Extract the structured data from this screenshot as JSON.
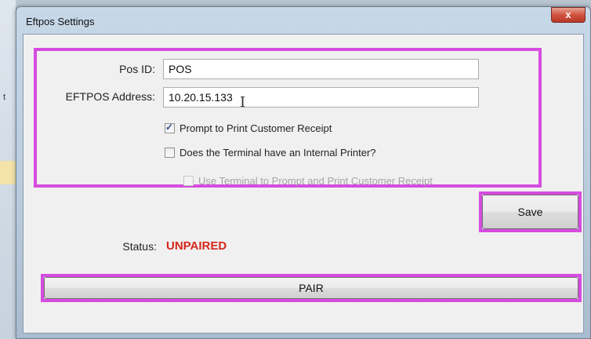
{
  "window": {
    "title": "Eftpos Settings",
    "close_label": "x"
  },
  "form": {
    "pos_id_label": "Pos ID:",
    "pos_id_value": "POS",
    "eftpos_address_label": "EFTPOS Address:",
    "eftpos_address_value": "10.20.15.133",
    "checkboxes": [
      {
        "label": "Prompt to Print Customer Receipt",
        "checked": true,
        "enabled": true
      },
      {
        "label": "Does the Terminal have an Internal Printer?",
        "checked": false,
        "enabled": true
      },
      {
        "label": "Use Terminal to Prompt and Print Customer Receipt",
        "checked": false,
        "enabled": false
      }
    ]
  },
  "save_label": "Save",
  "status": {
    "label": "Status:",
    "value": "UNPAIRED",
    "color": "#d6261c"
  },
  "pair_label": "PAIR",
  "highlight_color": "#d54ce0"
}
